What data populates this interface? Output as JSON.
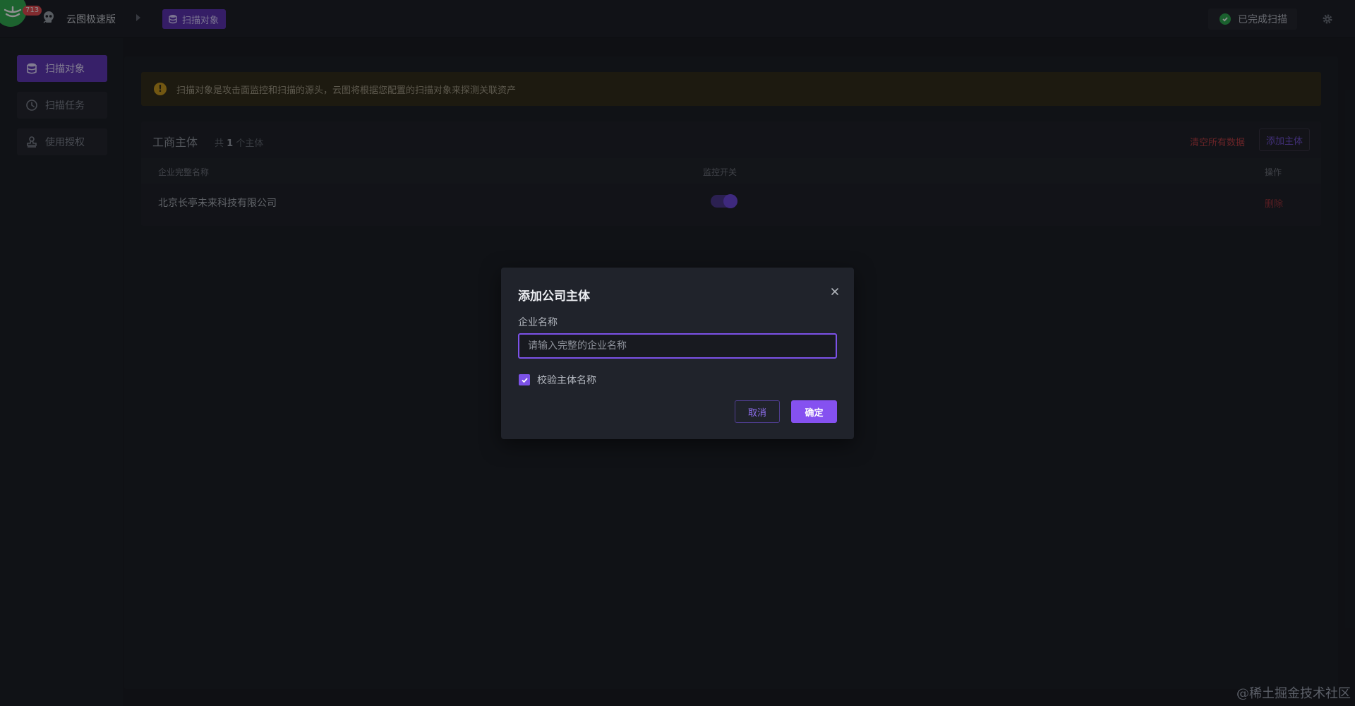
{
  "topbar": {
    "badge_count": "713",
    "app_name": "云图极速版",
    "breadcrumb_current": "扫描对象",
    "status_text": "已完成扫描"
  },
  "sidebar": {
    "items": [
      {
        "label": "扫描对象",
        "icon": "database-icon",
        "active": true
      },
      {
        "label": "扫描任务",
        "icon": "clock-icon",
        "active": false
      },
      {
        "label": "使用授权",
        "icon": "stamp-icon",
        "active": false
      }
    ]
  },
  "notice": {
    "text": "扫描对象是攻击面监控和扫描的源头，云图将根据您配置的扫描对象来探测关联资产"
  },
  "entities": {
    "title": "工商主体",
    "count_prefix": "共",
    "count_value": "1",
    "count_suffix": "个主体",
    "clear_all_label": "清空所有数据",
    "add_label": "添加主体",
    "columns": {
      "name": "企业完整名称",
      "monitor": "监控开关",
      "actions": "操作"
    },
    "rows": [
      {
        "name": "北京长亭未来科技有限公司",
        "monitor_on": true,
        "delete_label": "删除"
      }
    ]
  },
  "dialog": {
    "title": "添加公司主体",
    "field_label": "企业名称",
    "placeholder": "请输入完整的企业名称",
    "value": "",
    "checkbox_label": "校验主体名称",
    "checkbox_checked": true,
    "cancel_label": "取消",
    "ok_label": "确定"
  },
  "watermark": "@稀土掘金技术社区",
  "colors": {
    "accent": "#7c52e8",
    "success": "#29a84b",
    "warning": "#c99818",
    "danger": "#b73a3f"
  }
}
